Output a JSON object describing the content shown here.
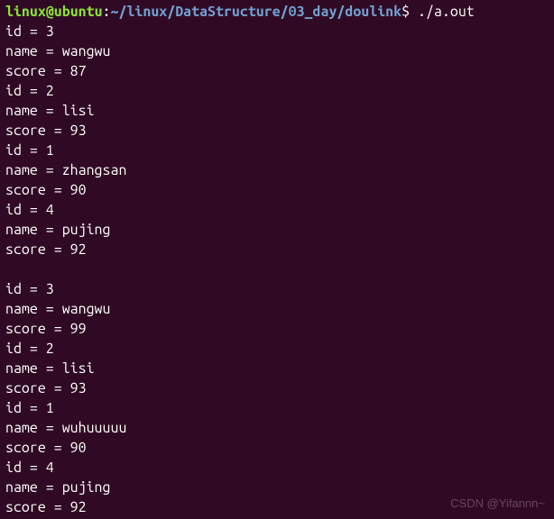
{
  "prompt": {
    "user": "linux",
    "at": "@",
    "host": "ubuntu",
    "colon": ":",
    "path": "~/linux/DataStructure/03_day/doulink",
    "dollar": "$",
    "command": "./a.out"
  },
  "lines": [
    "id = 3",
    "name = wangwu",
    "score = 87",
    "id = 2",
    "name = lisi",
    "score = 93",
    "id = 1",
    "name = zhangsan",
    "score = 90",
    "id = 4",
    "name = pujing",
    "score = 92",
    "",
    "id = 3",
    "name = wangwu",
    "score = 99",
    "id = 2",
    "name = lisi",
    "score = 93",
    "id = 1",
    "name = wuhuuuuu",
    "score = 90",
    "id = 4",
    "name = pujing",
    "score = 92"
  ],
  "watermark": "CSDN @Yifannn~"
}
